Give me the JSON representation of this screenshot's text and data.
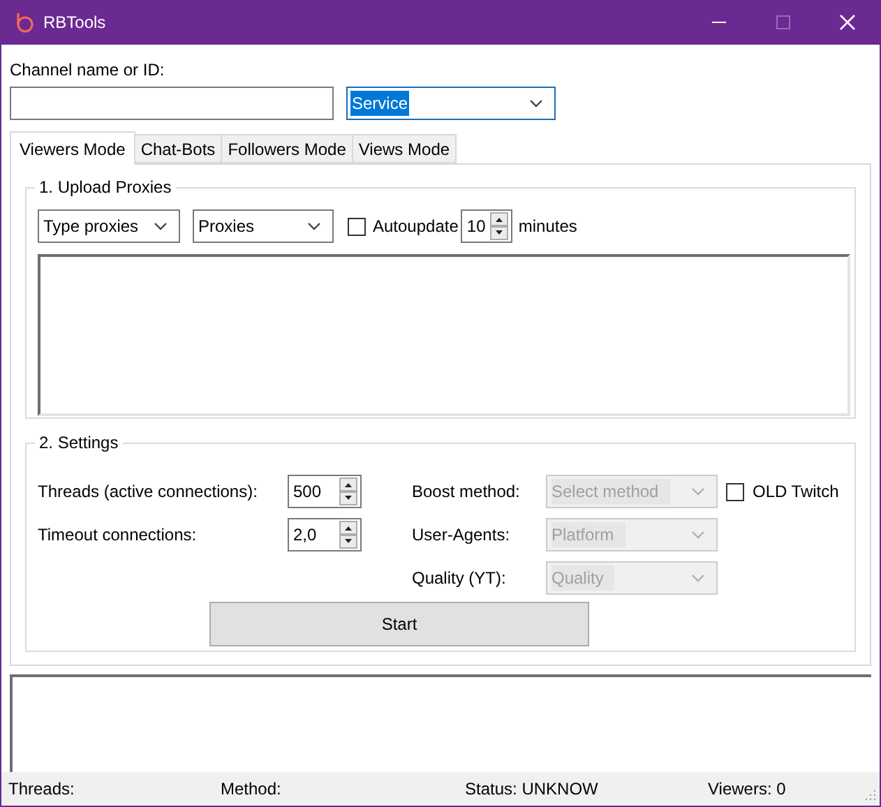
{
  "window": {
    "title": "RBTools",
    "maximize_disabled": true
  },
  "channel": {
    "label": "Channel name or ID:"
  },
  "service": {
    "value": "Service"
  },
  "tabs": [
    {
      "label": "Viewers Mode",
      "selected": true
    },
    {
      "label": "Chat-Bots",
      "selected": false
    },
    {
      "label": "Followers Mode",
      "selected": false
    },
    {
      "label": "Views Mode",
      "selected": false
    }
  ],
  "upload_proxies": {
    "title": "1. Upload Proxies",
    "type_select": "Type proxies",
    "proxies_select": "Proxies",
    "autoupdate": {
      "label": "Autoupdate",
      "checked": false
    },
    "interval": "10",
    "unit": "minutes"
  },
  "settings": {
    "title": "2. Settings",
    "spinners": [
      {
        "label": "Threads (active connections):",
        "value": "500"
      },
      {
        "label": "Timeout connections:",
        "value": "2,0"
      }
    ],
    "selects": [
      {
        "label": "Boost method:",
        "value": "Select method",
        "disabled": true
      },
      {
        "label": "User-Agents:",
        "value": "Platform",
        "disabled": true
      },
      {
        "label": "Quality (YT):",
        "value": "Quality",
        "disabled": true
      }
    ],
    "old_twitch": {
      "label": "OLD Twitch",
      "checked": false
    },
    "start": "Start"
  },
  "status_bar": [
    "Threads:",
    "Method:",
    "Status: UNKNOW",
    "Viewers: 0"
  ]
}
